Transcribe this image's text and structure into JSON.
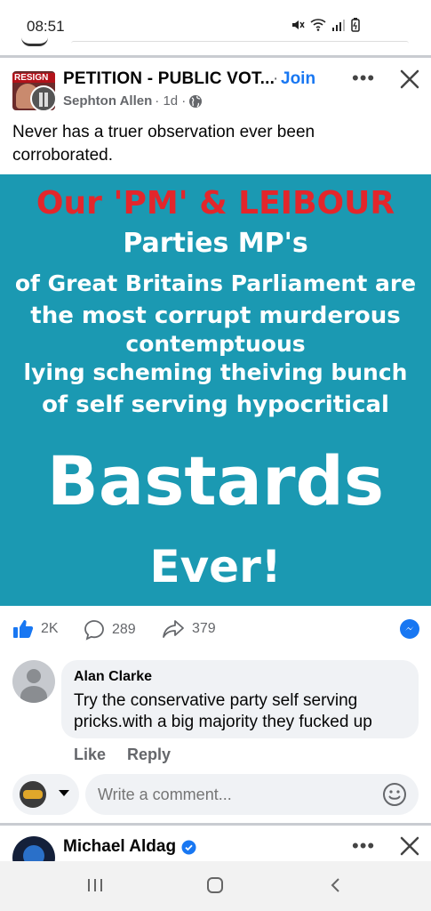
{
  "status_bar": {
    "time": "08:51"
  },
  "post": {
    "group_name": "PETITION - PUBLIC VOT...",
    "separator": "·",
    "join_label": "Join",
    "author": "Sephton Allen",
    "age": "· 1d ·",
    "text": "Never has a truer observation ever been corroborated.",
    "avatar_badge": "RESIGN",
    "image_text": {
      "line1": "Our 'PM' & LEIBOUR",
      "line2": "Parties MP's",
      "line3": "of Great Britains Parliament are",
      "line4": "the most corrupt murderous",
      "line5": "contemptuous",
      "line6": "lying scheming theiving bunch",
      "line7": "of self serving hypocritical",
      "line8": "Bastards",
      "line9": "Ever!"
    },
    "likes": "2K",
    "comments": "289",
    "shares": "379"
  },
  "comment": {
    "author": "Alan Clarke",
    "text": "Try the conservative party self serving pricks.with a big majority they fucked up",
    "like_label": "Like",
    "reply_label": "Reply"
  },
  "composer": {
    "placeholder": "Write a comment..."
  },
  "next_post": {
    "author": "Michael Aldag"
  },
  "colors": {
    "accent": "#1877f2",
    "image_bg": "#1b99b2",
    "headline_red": "#e3262b"
  },
  "icons": [
    "globe-icon",
    "more-icon",
    "close-icon",
    "like-icon",
    "comment-icon",
    "share-icon",
    "messenger-icon",
    "smiley-icon",
    "verified-icon",
    "recents-icon",
    "home-icon",
    "back-icon"
  ]
}
